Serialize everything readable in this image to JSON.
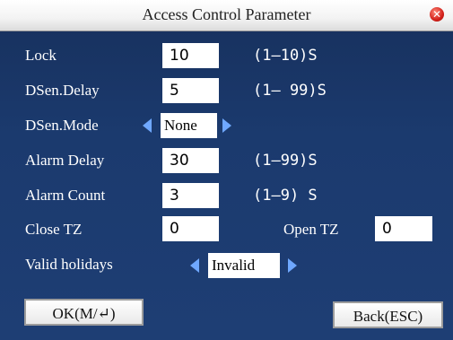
{
  "window": {
    "title": "Access Control Parameter",
    "close_glyph": "✕"
  },
  "rows": {
    "lock": {
      "label": "Lock",
      "value": "10",
      "range": "(1—10)S"
    },
    "dsen_delay": {
      "label": "DSen.Delay",
      "value": "5",
      "range": "(1— 99)S"
    },
    "dsen_mode": {
      "label": "DSen.Mode",
      "value": "None"
    },
    "alarm_delay": {
      "label": "Alarm Delay",
      "value": "30",
      "range": "(1—99)S"
    },
    "alarm_count": {
      "label": "Alarm Count",
      "value": "3",
      "range": "(1—9) S"
    },
    "close_tz": {
      "label": "Close TZ",
      "value": "0"
    },
    "open_tz": {
      "label": "Open TZ",
      "value": "0"
    },
    "valid_holidays": {
      "label": "Valid holidays",
      "value": "Invalid"
    }
  },
  "buttons": {
    "ok_label": "OK(M/↵)",
    "back_label": "Back(ESC)"
  },
  "icons": {
    "close": "close-icon",
    "prev": "arrow-left-icon",
    "next": "arrow-right-icon"
  },
  "colors": {
    "background": "#1b3a6e",
    "arrow": "#6fa8ff",
    "close": "#d2201a"
  }
}
